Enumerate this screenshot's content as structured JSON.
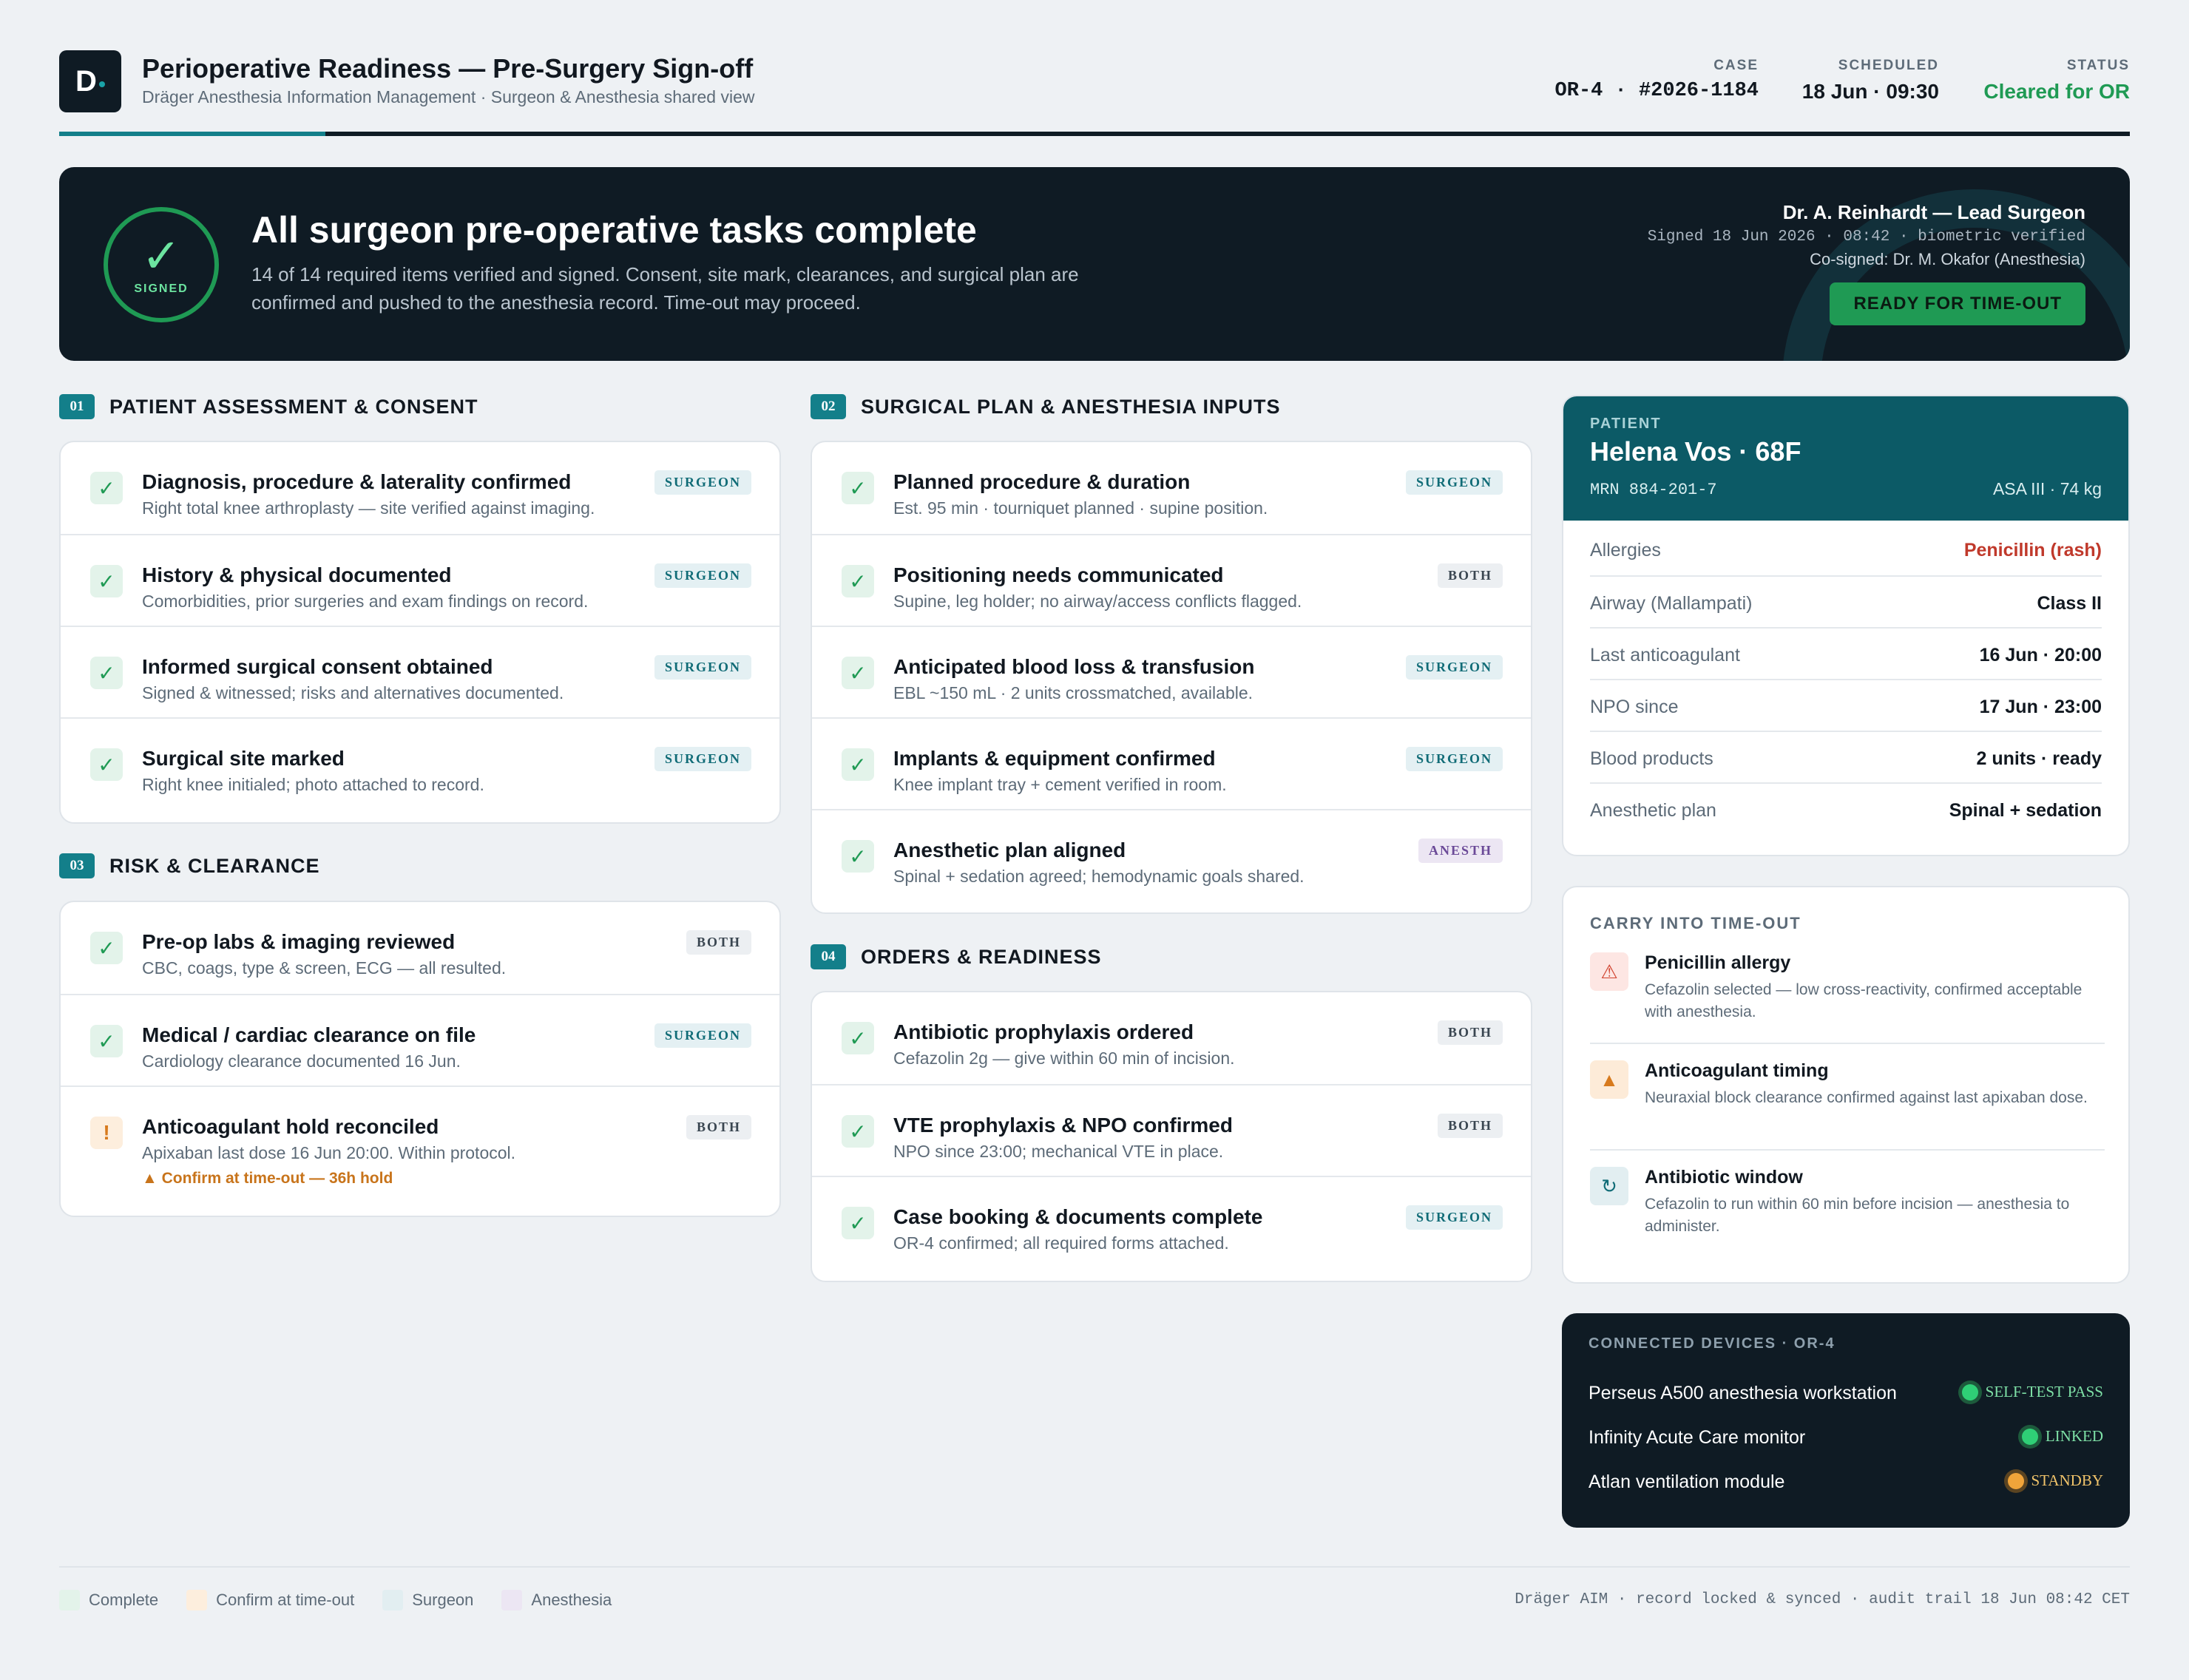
{
  "header": {
    "logo_letter": "D",
    "title": "Perioperative Readiness — Pre-Surgery Sign-off",
    "subtitle": "Dräger Anesthesia Information Management · Surgeon & Anesthesia shared view",
    "case_label": "CASE",
    "case_value": "OR-4 · #2026-1184",
    "scheduled_label": "SCHEDULED",
    "scheduled_value": "18 Jun · 09:30",
    "status_label": "STATUS",
    "status_value": "Cleared for OR",
    "status_color": "#1f9a54"
  },
  "banner": {
    "seal_icon": "check-icon",
    "seal_glyph": "✓",
    "seal_text": "SIGNED",
    "title": "All surgeon pre-operative tasks complete",
    "text": "14 of 14 required items verified and signed. Consent, site mark, clearances, and surgical plan are confirmed and pushed to the anesthesia record. Time-out may proceed.",
    "signer": "Dr. A. Reinhardt — Lead Surgeon",
    "signed_line": "Signed 18 Jun 2026 · 08:42 · biometric verified",
    "cosigned": "Co-signed: Dr. M. Okafor (Anesthesia)",
    "button": "READY FOR TIME-OUT"
  },
  "sections": {
    "s01": {
      "num": "01",
      "title": "PATIENT ASSESSMENT & CONSENT",
      "items": [
        {
          "title": "Diagnosis, procedure & laterality confirmed",
          "desc": "Right total knee arthroplasty — site verified against imaging.",
          "tag": "SURGEON"
        },
        {
          "title": "History & physical documented",
          "desc": "Comorbidities, prior surgeries and exam findings on record.",
          "tag": "SURGEON"
        },
        {
          "title": "Informed surgical consent obtained",
          "desc": "Signed & witnessed; risks and alternatives documented.",
          "tag": "SURGEON"
        },
        {
          "title": "Surgical site marked",
          "desc": "Right knee initialed; photo attached to record.",
          "tag": "SURGEON"
        }
      ]
    },
    "s02": {
      "num": "02",
      "title": "SURGICAL PLAN & ANESTHESIA INPUTS",
      "items": [
        {
          "title": "Planned procedure & duration",
          "desc": "Est. 95 min · tourniquet planned · supine position.",
          "tag": "SURGEON"
        },
        {
          "title": "Positioning needs communicated",
          "desc": "Supine, leg holder; no airway/access conflicts flagged.",
          "tag": "BOTH"
        },
        {
          "title": "Anticipated blood loss & transfusion",
          "desc": "EBL ~150 mL · 2 units crossmatched, available.",
          "tag": "SURGEON"
        },
        {
          "title": "Implants & equipment confirmed",
          "desc": "Knee implant tray + cement verified in room.",
          "tag": "SURGEON"
        },
        {
          "title": "Anesthetic plan aligned",
          "desc": "Spinal + sedation agreed; hemodynamic goals shared.",
          "tag": "ANESTH"
        }
      ]
    },
    "s03": {
      "num": "03",
      "title": "RISK & CLEARANCE",
      "items": [
        {
          "title": "Pre-op labs & imaging reviewed",
          "desc": "CBC, coags, type & screen, ECG — all resulted.",
          "tag": "BOTH"
        },
        {
          "title": "Medical / cardiac clearance on file",
          "desc": "Cardiology clearance documented 16 Jun.",
          "tag": "SURGEON"
        },
        {
          "title": "Anticoagulant hold reconciled",
          "desc": "Apixaban last dose 16 Jun 20:00. Within protocol.",
          "tag": "BOTH",
          "note": "▲ Confirm at time-out — 36h hold"
        }
      ]
    },
    "s04": {
      "num": "04",
      "title": "ORDERS & READINESS",
      "items": [
        {
          "title": "Antibiotic prophylaxis ordered",
          "desc": "Cefazolin 2g — give within 60 min of incision.",
          "tag": "BOTH"
        },
        {
          "title": "VTE prophylaxis & NPO confirmed",
          "desc": "NPO since 23:00; mechanical VTE in place.",
          "tag": "BOTH"
        },
        {
          "title": "Case booking & documents complete",
          "desc": "OR-4 confirmed; all required forms attached.",
          "tag": "SURGEON"
        }
      ]
    }
  },
  "glyphs": {
    "check": "✓",
    "warn": "!"
  },
  "patient": {
    "label": "PATIENT",
    "name": "Helena Vos · 68F",
    "mrn": "MRN 884-201-7",
    "asa": "ASA III · 74 kg",
    "rows": [
      {
        "k": "Allergies",
        "v": "Penicillin (rash)"
      },
      {
        "k": "Airway (Mallampati)",
        "v": "Class II"
      },
      {
        "k": "Last anticoagulant",
        "v": "16 Jun · 20:00"
      },
      {
        "k": "NPO since",
        "v": "17 Jun · 23:00"
      },
      {
        "k": "Blood products",
        "v": "2 units · ready"
      },
      {
        "k": "Anesthetic plan",
        "v": "Spinal + sedation"
      }
    ],
    "alert_color": "#c0392b"
  },
  "carry": {
    "label": "CARRY INTO TIME-OUT",
    "items": [
      {
        "icon": "warning-triangle-icon",
        "glyph": "⚠",
        "title": "Penicillin allergy",
        "desc": "Cefazolin selected — low cross-reactivity, confirmed acceptable with anesthesia."
      },
      {
        "icon": "caution-triangle-icon",
        "glyph": "▲",
        "title": "Anticoagulant timing",
        "desc": "Neuraxial block clearance confirmed against last apixaban dose."
      },
      {
        "icon": "refresh-icon",
        "glyph": "↻",
        "title": "Antibiotic window",
        "desc": "Cefazolin to run within 60 min before incision — anesthesia to administer."
      }
    ]
  },
  "devices": {
    "label": "CONNECTED DEVICES · OR-4",
    "items": [
      {
        "name": "Perseus A500 anesthesia workstation",
        "status": "SELF-TEST PASS"
      },
      {
        "name": "Infinity Acute Care monitor",
        "status": "LINKED"
      },
      {
        "name": "Atlan ventilation module",
        "status": "STANDBY"
      }
    ]
  },
  "footer": {
    "legend": [
      "Complete",
      "Confirm at time-out",
      "Surgeon",
      "Anesthesia"
    ],
    "note": "Dräger AIM · record locked & synced · audit trail 18 Jun 08:42 CET"
  }
}
